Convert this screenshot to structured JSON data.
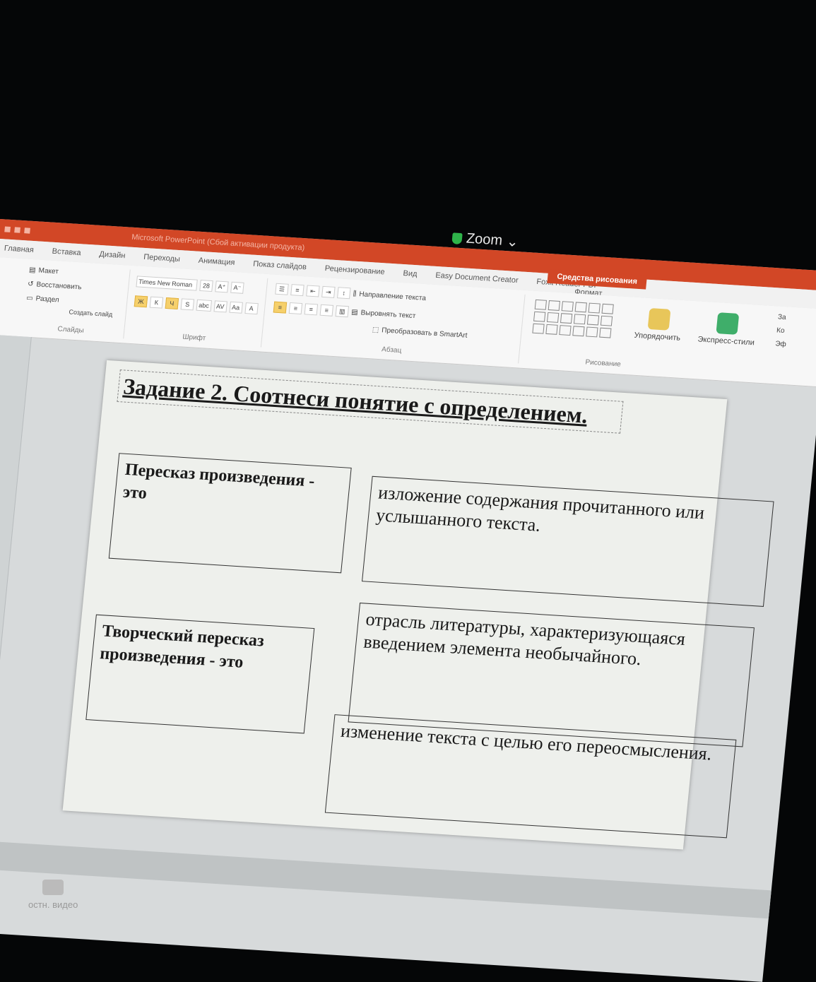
{
  "zoom": {
    "label": "Zoom"
  },
  "window": {
    "title": "Microsoft PowerPoint (Сбой активации продукта)"
  },
  "tabs": [
    {
      "label": "Главная"
    },
    {
      "label": "Вставка"
    },
    {
      "label": "Дизайн"
    },
    {
      "label": "Переходы"
    },
    {
      "label": "Анимация"
    },
    {
      "label": "Показ слайдов"
    },
    {
      "label": "Рецензирование"
    },
    {
      "label": "Вид"
    },
    {
      "label": "Easy Document Creator"
    },
    {
      "label": "Foxit Reader PDF"
    }
  ],
  "context_tab": {
    "group": "Средства рисования",
    "label": "Формат"
  },
  "ribbon": {
    "slides": {
      "layout": "Макет",
      "reset": "Восстановить",
      "new_slide": "Создать слайд",
      "section": "Раздел",
      "label": "Слайды"
    },
    "font": {
      "name": "Times New Roman",
      "size": "28",
      "label": "Шрифт"
    },
    "paragraph": {
      "text_direction": "Направление текста",
      "align_text": "Выровнять текст",
      "smartart": "Преобразовать в SmartArt",
      "label": "Абзац"
    },
    "drawing": {
      "arrange": "Упорядочить",
      "quick_styles": "Экспресс-стили",
      "label": "Рисование"
    },
    "right_cut": [
      "За",
      "Ко",
      "Эф"
    ]
  },
  "slide": {
    "title": "Задание 2. Соотнеси понятие с определением.",
    "terms": [
      "Пересказ произведения - это",
      "Творческий пересказ произведения - это"
    ],
    "definitions": [
      "изложение содержания прочитанного или услышанного текста.",
      "отрасль литературы, характеризующаяся введением элемента необычайного.",
      "изменение текста с целью его переосмысления."
    ]
  },
  "zoom_controls": {
    "video": "остн. видео"
  }
}
